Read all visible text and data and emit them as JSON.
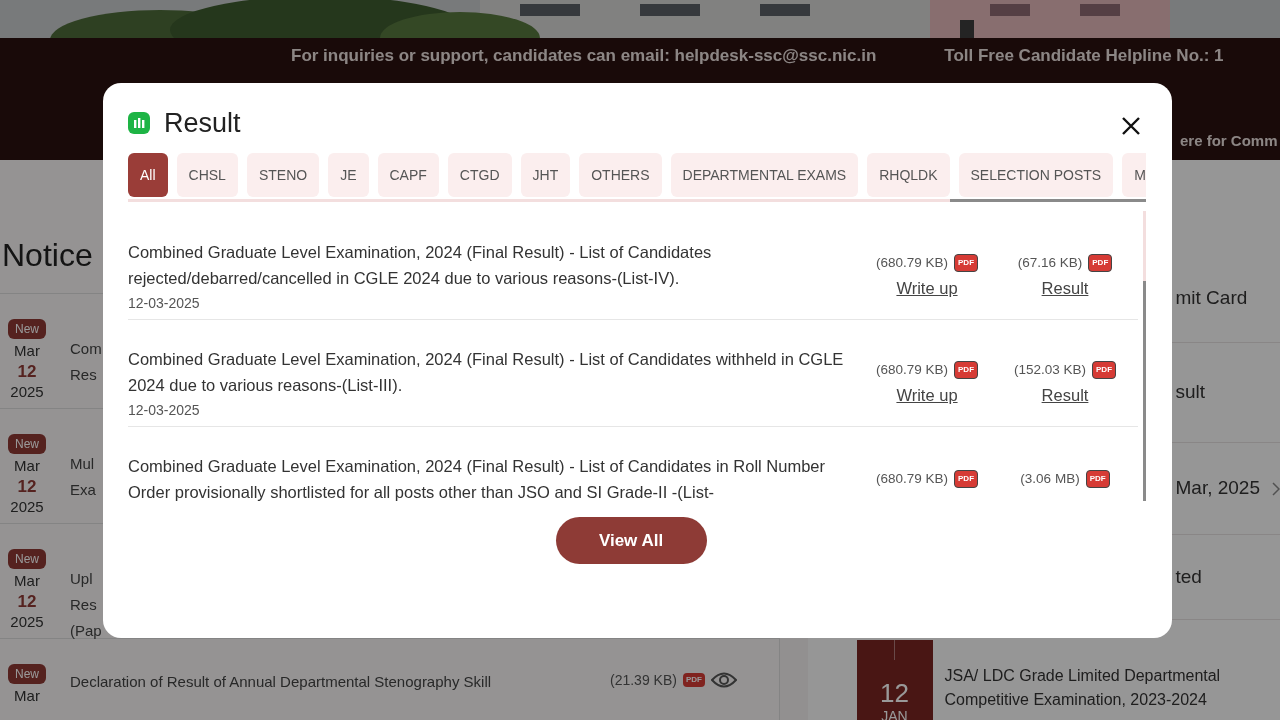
{
  "info_bar": {
    "messages": [
      "For inquiries or support, candidates can email: helpdesk-ssc@ssc.nic.in",
      "Toll Free Candidate Helpline No.: 1"
    ],
    "second_line": "ere for Comm"
  },
  "notices": {
    "title": "Notice",
    "items": [
      {
        "badge": "New",
        "month": "Mar",
        "day": "12",
        "year": "2025",
        "title_lines": [
          "Com",
          "Res"
        ]
      },
      {
        "badge": "New",
        "month": "Mar",
        "day": "12",
        "year": "2025",
        "title_lines": [
          "Mul",
          "Exa"
        ]
      },
      {
        "badge": "New",
        "month": "Mar",
        "day": "12",
        "year": "2025",
        "title_lines": [
          "Upl",
          "Res",
          "(Pap"
        ]
      },
      {
        "badge": "New",
        "month": "Mar",
        "title_lines": [
          "Declaration of Result of Annual Departmental Stenography Skill"
        ],
        "size": "(21.39 KB)",
        "file_badge": "PDF"
      }
    ]
  },
  "side_panel": {
    "items": [
      {
        "text": "mit Card"
      },
      {
        "text": "sult"
      },
      {
        "text": "Mar, 2025"
      },
      {
        "text": "ted"
      }
    ],
    "event": {
      "day": "12",
      "month": "JAN",
      "lines": [
        "JSA/ LDC Grade Limited Departmental",
        "Competitive Examination, 2023-2024"
      ]
    }
  },
  "modal": {
    "title": "Result",
    "tabs": [
      {
        "label": "All",
        "selected": true
      },
      {
        "label": "CHSL",
        "selected": false
      },
      {
        "label": "STENO",
        "selected": false
      },
      {
        "label": "JE",
        "selected": false
      },
      {
        "label": "CAPF",
        "selected": false
      },
      {
        "label": "CTGD",
        "selected": false
      },
      {
        "label": "JHT",
        "selected": false
      },
      {
        "label": "OTHERS",
        "selected": false
      },
      {
        "label": "DEPARTMENTAL EXAMS",
        "selected": false
      },
      {
        "label": "RHQLDK",
        "selected": false
      },
      {
        "label": "SELECTION POSTS",
        "selected": false
      },
      {
        "label": "M",
        "selected": false
      }
    ],
    "results": [
      {
        "title": "Combined Graduate Level Examination, 2024 (Final Result) - List of Candidates rejected/debarred/cancelled in CGLE 2024 due to various reasons-(List-IV).",
        "date": "12-03-2025",
        "files": [
          {
            "size": "(680.79 KB)",
            "badge": "PDF",
            "link": "Write up"
          },
          {
            "size": "(67.16 KB)",
            "badge": "PDF",
            "link": "Result"
          }
        ]
      },
      {
        "title": "Combined Graduate Level Examination, 2024 (Final Result) - List of Candidates withheld in CGLE 2024 due to various reasons-(List-III).",
        "date": "12-03-2025",
        "files": [
          {
            "size": "(680.79 KB)",
            "badge": "PDF",
            "link": "Write up"
          },
          {
            "size": "(152.03 KB)",
            "badge": "PDF",
            "link": "Result"
          }
        ]
      },
      {
        "title": "Combined Graduate Level Examination, 2024 (Final Result) - List of Candidates in Roll Number Order provisionally shortlisted for all posts other than JSO and SI Grade-II -(List-",
        "files": [
          {
            "size": "(680.79 KB)",
            "badge": "PDF"
          },
          {
            "size": "(3.06 MB)",
            "badge": "PDF"
          }
        ]
      }
    ],
    "view_all": "View All"
  }
}
